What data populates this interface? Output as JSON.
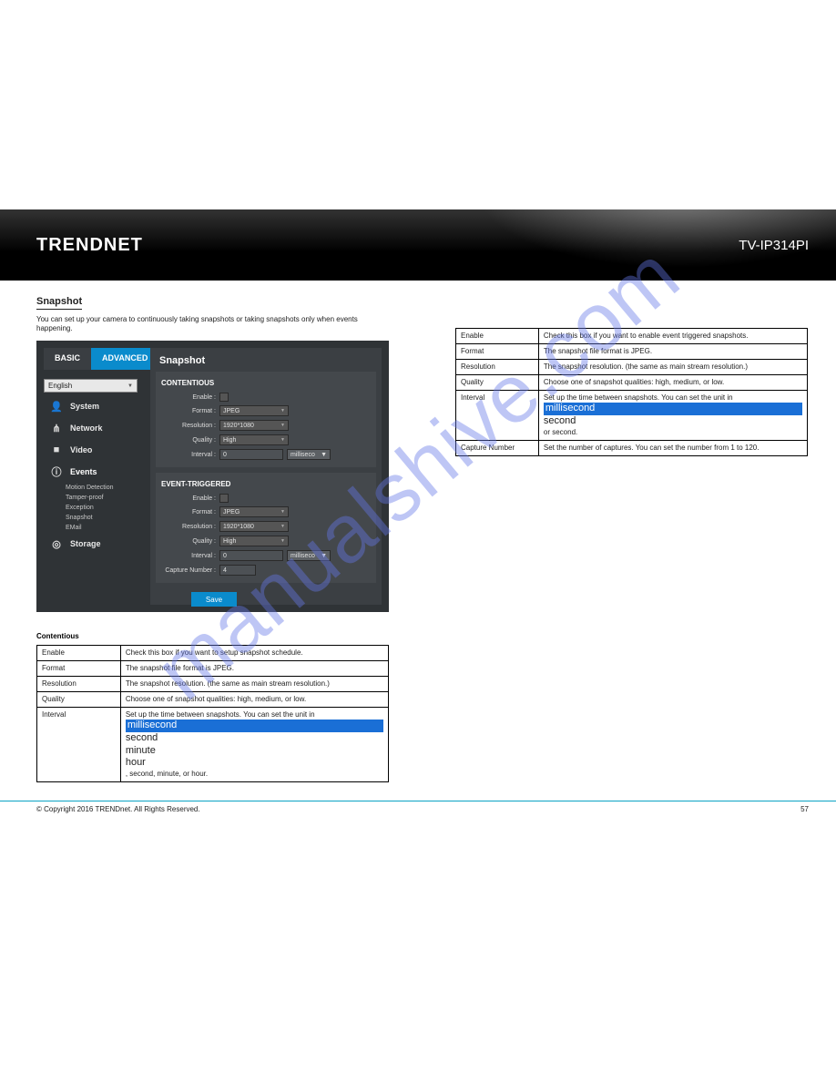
{
  "watermark": "manualshive.com",
  "banner": {
    "brand": "TRENDNET",
    "model": "TV-IP314PI"
  },
  "section": {
    "title": "Snapshot",
    "desc": "You can set up your camera to continuously taking snapshots or taking snapshots only when events happening."
  },
  "app": {
    "tabs": {
      "basic": "BASIC",
      "advanced": "ADVANCED"
    },
    "language": "English",
    "nav": {
      "system": "System",
      "network": "Network",
      "video": "Video",
      "events": "Events",
      "sub": [
        "Motion Detection",
        "Tamper-proof",
        "Exception",
        "Snapshot",
        "EMail"
      ],
      "storage": "Storage"
    },
    "panel_title": "Snapshot",
    "groups": {
      "cont": {
        "title": "CONTENTIOUS",
        "enable": "Enable",
        "format_lbl": "Format",
        "format": "JPEG",
        "resolution_lbl": "Resolution",
        "resolution": "1920*1080",
        "quality_lbl": "Quality",
        "quality": "High",
        "interval_lbl": "Interval",
        "interval_val": "0",
        "interval_unit": "milliseco"
      },
      "trig": {
        "title": "EVENT-TRIGGERED",
        "enable": "Enable",
        "format_lbl": "Format",
        "format": "JPEG",
        "resolution_lbl": "Resolution",
        "resolution": "1920*1080",
        "quality_lbl": "Quality",
        "quality": "High",
        "interval_lbl": "Interval",
        "interval_val": "0",
        "interval_unit": "milliseco",
        "captnum_lbl": "Capture Number",
        "captnum": "4"
      }
    },
    "save": "Save"
  },
  "table_left": {
    "heading": "Contentious",
    "rows": [
      {
        "k": "Enable",
        "v": "Check this box if you want to setup snapshot schedule."
      },
      {
        "k": "Format",
        "v": "The snapshot file format is JPEG."
      },
      {
        "k": "Resolution",
        "v": "The snapshot resolution. (the same as main stream resolution.)"
      },
      {
        "k": "Quality",
        "v": "Choose one of snapshot qualities: high, medium, or low."
      },
      {
        "k": "Interval",
        "v_prefix": "Set up the time between snapshots. You can set the unit in ",
        "opts": [
          "millisecond",
          "second",
          "minute",
          "hour"
        ],
        "suffix": ", second, minute, or hour."
      }
    ]
  },
  "table_right": {
    "rows": [
      {
        "k": "Enable",
        "v": "Check this box if you want to enable event triggered snapshots."
      },
      {
        "k": "Format",
        "v": "The snapshot file format is JPEG."
      },
      {
        "k": "Resolution",
        "v": "The snapshot resolution. (the same as main stream resolution.)"
      },
      {
        "k": "Quality",
        "v": "Choose one of snapshot qualities: high, medium, or low."
      },
      {
        "k": "Interval",
        "v_prefix": "Set up the time between snapshots. You can set the unit in ",
        "opts": [
          "millisecond",
          "second"
        ],
        "suffix": " or second."
      },
      {
        "k": "Capture Number",
        "v": "Set the number of captures. You can set the number from 1 to 120."
      }
    ]
  },
  "footer": {
    "copy": "© Copyright 2016 TRENDnet. All Rights Reserved.",
    "page": "57"
  }
}
